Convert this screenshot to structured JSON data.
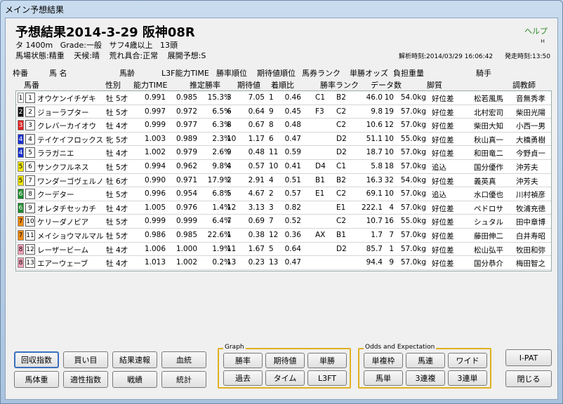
{
  "window": {
    "title": "メイン予想結果"
  },
  "header": {
    "title": "予想結果2014-3-29 阪神08R",
    "help": "ヘルプ",
    "help_mini": "н",
    "course": "タ 1400m",
    "grade": "Grade:一般",
    "condition": "サフ4歳以上",
    "runners": "13頭",
    "track": "馬場状態:精重",
    "weather": "天候:晴",
    "rough": "荒れ具合:正常",
    "pace": "展開予想:S",
    "analyzed": "解析時刻:2014/03/29 16:06:42",
    "post": "発走時刻:13:50"
  },
  "columns_row1": [
    "枠番",
    "馬 名",
    "馬齢",
    "L3F能力TIME",
    "勝率順位",
    "期待値順位",
    "馬券ランク",
    "単勝オッズ",
    "負担重量",
    "騎手"
  ],
  "columns_row2": [
    "馬番",
    "性別",
    "能力TIME",
    "推定勝率",
    "期待値",
    "着順比",
    "勝率ランク",
    "データ数",
    "脚質",
    "調教師"
  ],
  "rows": [
    {
      "waku": "1",
      "umaban": "1",
      "name": "オウケンイチゲキ",
      "sex": "牡",
      "age": "5才",
      "t1": "0.991",
      "t2": "0.985",
      "win": "15.3%",
      "wrank": "3",
      "ev": "7.05",
      "evrank": "1",
      "ratio": "0.46",
      "brank": "C1",
      "rrank": "B2",
      "odds": "46.0",
      "data": "10",
      "wt": "54.0kg",
      "style": "好位差",
      "jockey": "松若風馬",
      "trainer": "音無秀孝"
    },
    {
      "waku": "2",
      "umaban": "2",
      "name": "ジョーラプター",
      "sex": "牡",
      "age": "5才",
      "t1": "0.997",
      "t2": "0.972",
      "win": "6.5%",
      "wrank": "6",
      "ev": "0.64",
      "evrank": "9",
      "ratio": "0.45",
      "brank": "F3",
      "rrank": "C2",
      "odds": "9.8",
      "data": "19",
      "wt": "57.0kg",
      "style": "好位差",
      "jockey": "北村宏司",
      "trainer": "柴田光陽"
    },
    {
      "waku": "3",
      "umaban": "3",
      "name": "クレバーカイオウ",
      "sex": "牡",
      "age": "4才",
      "t1": "0.999",
      "t2": "0.977",
      "win": "6.3%",
      "wrank": "8",
      "ev": "0.67",
      "evrank": "8",
      "ratio": "0.48",
      "brank": "",
      "rrank": "C2",
      "odds": "10.6",
      "data": "12",
      "wt": "57.0kg",
      "style": "好位差",
      "jockey": "柴田大知",
      "trainer": "小西一男"
    },
    {
      "waku": "4",
      "umaban": "4",
      "name": "テイケイフロックス",
      "sex": "牝",
      "age": "5才",
      "t1": "1.003",
      "t2": "0.989",
      "win": "2.3%",
      "wrank": "10",
      "ev": "1.17",
      "evrank": "6",
      "ratio": "0.47",
      "brank": "",
      "rrank": "D2",
      "odds": "51.1",
      "data": "10",
      "wt": "55.0kg",
      "style": "好位差",
      "jockey": "秋山真一",
      "trainer": "大橋勇樹"
    },
    {
      "waku": "4",
      "umaban": "5",
      "name": "ララガニエ",
      "sex": "牡",
      "age": "4才",
      "t1": "1.002",
      "t2": "0.979",
      "win": "2.6%",
      "wrank": "9",
      "ev": "0.48",
      "evrank": "11",
      "ratio": "0.59",
      "brank": "",
      "rrank": "D2",
      "odds": "18.7",
      "data": "10",
      "wt": "57.0kg",
      "style": "好位差",
      "jockey": "和田竜二",
      "trainer": "今野貞一"
    },
    {
      "waku": "5",
      "umaban": "6",
      "name": "サンクフルネス",
      "sex": "牡",
      "age": "5才",
      "t1": "0.994",
      "t2": "0.962",
      "win": "9.8%",
      "wrank": "4",
      "ev": "0.57",
      "evrank": "10",
      "ratio": "0.41",
      "brank": "D4",
      "rrank": "C1",
      "odds": "5.8",
      "data": "18",
      "wt": "57.0kg",
      "style": "追込",
      "jockey": "国分優作",
      "trainer": "沖芳夫"
    },
    {
      "waku": "5",
      "umaban": "7",
      "name": "ワンダーゴヴェルノ",
      "sex": "牡",
      "age": "6才",
      "t1": "0.990",
      "t2": "0.971",
      "win": "17.9%",
      "wrank": "2",
      "ev": "2.91",
      "evrank": "4",
      "ratio": "0.51",
      "brank": "B1",
      "rrank": "B2",
      "odds": "16.3",
      "data": "32",
      "wt": "54.0kg",
      "style": "好位差",
      "jockey": "義英真",
      "trainer": "沖芳夫"
    },
    {
      "waku": "6",
      "umaban": "8",
      "name": "クーデター",
      "sex": "牡",
      "age": "5才",
      "t1": "0.996",
      "t2": "0.954",
      "win": "6.8%",
      "wrank": "5",
      "ev": "4.67",
      "evrank": "2",
      "ratio": "0.57",
      "brank": "E1",
      "rrank": "C2",
      "odds": "69.1",
      "data": "10",
      "wt": "57.0kg",
      "style": "追込",
      "jockey": "水口優也",
      "trainer": "川村禎彦"
    },
    {
      "waku": "6",
      "umaban": "9",
      "name": "オレタチセッカチ",
      "sex": "牡",
      "age": "4才",
      "t1": "1.005",
      "t2": "0.976",
      "win": "1.4%",
      "wrank": "12",
      "ev": "3.13",
      "evrank": "3",
      "ratio": "0.82",
      "brank": "",
      "rrank": "E1",
      "odds": "222.1",
      "data": "4",
      "wt": "57.0kg",
      "style": "好位差",
      "jockey": "ペドロサ",
      "trainer": "牧浦充徳"
    },
    {
      "waku": "7",
      "umaban": "10",
      "name": "ケリーダノビア",
      "sex": "牡",
      "age": "5才",
      "t1": "0.999",
      "t2": "0.999",
      "win": "6.4%",
      "wrank": "7",
      "ev": "0.69",
      "evrank": "7",
      "ratio": "0.52",
      "brank": "",
      "rrank": "C2",
      "odds": "10.7",
      "data": "16",
      "wt": "55.0kg",
      "style": "好位差",
      "jockey": "シュタル",
      "trainer": "田中章博"
    },
    {
      "waku": "7",
      "umaban": "11",
      "name": "メイショウマルマル",
      "sex": "牡",
      "age": "5才",
      "t1": "0.986",
      "t2": "0.985",
      "win": "22.6%",
      "wrank": "1",
      "ev": "0.38",
      "evrank": "12",
      "ratio": "0.36",
      "brank": "AX",
      "rrank": "B1",
      "odds": "1.7",
      "data": "7",
      "wt": "57.0kg",
      "style": "好位差",
      "jockey": "藤田伸二",
      "trainer": "白井寿昭"
    },
    {
      "waku": "8",
      "umaban": "12",
      "name": "レーザービーム",
      "sex": "牡",
      "age": "4才",
      "t1": "1.006",
      "t2": "1.000",
      "win": "1.9%",
      "wrank": "11",
      "ev": "1.67",
      "evrank": "5",
      "ratio": "0.64",
      "brank": "",
      "rrank": "D2",
      "odds": "85.7",
      "data": "1",
      "wt": "57.0kg",
      "style": "好位差",
      "jockey": "松山弘平",
      "trainer": "牧田和弥"
    },
    {
      "waku": "8",
      "umaban": "13",
      "name": "エアーウェーブ",
      "sex": "牡",
      "age": "4才",
      "t1": "1.013",
      "t2": "1.002",
      "win": "0.2%",
      "wrank": "13",
      "ev": "0.23",
      "evrank": "13",
      "ratio": "0.47",
      "brank": "",
      "rrank": "",
      "odds": "94.4",
      "data": "9",
      "wt": "57.0kg",
      "style": "好位差",
      "jockey": "国分恭介",
      "trainer": "梅田智之"
    }
  ],
  "waku_colors": {
    "1": "#ffffff",
    "2": "#111111",
    "3": "#e02020",
    "4": "#1a2fd0",
    "5": "#f2e600",
    "6": "#1a8a2a",
    "7": "#f08a10",
    "8": "#f5a0b8"
  },
  "buttons_left": [
    "回収指数",
    "買い目",
    "結果速報",
    "血統",
    "馬体重",
    "適性指数",
    "戦績",
    "統計"
  ],
  "graph": {
    "label": "Graph",
    "buttons": [
      "勝率",
      "期待値",
      "単勝",
      "過去",
      "タイム",
      "L3FT"
    ]
  },
  "odds": {
    "label": "Odds and Expectation",
    "buttons": [
      "単複枠",
      "馬連",
      "ワイド",
      "馬単",
      "3連複",
      "3連単"
    ]
  },
  "right_buttons": [
    "I-PAT",
    "閉じる"
  ]
}
